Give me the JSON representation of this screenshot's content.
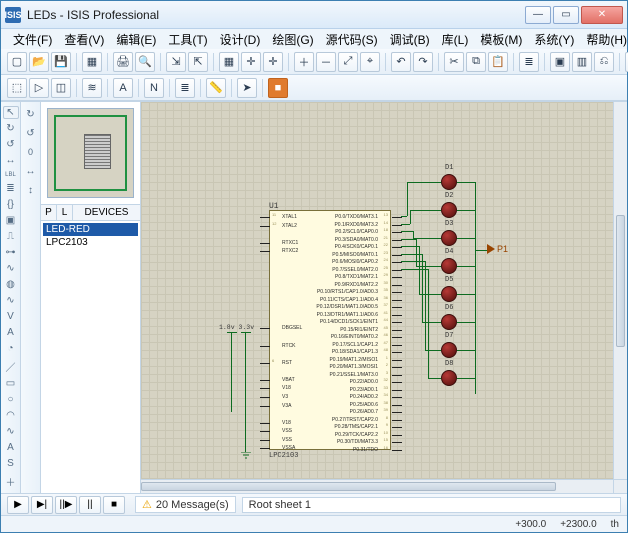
{
  "window": {
    "app_icon_text": "ISIS",
    "title": "LEDs - ISIS Professional",
    "btn_min": "—",
    "btn_max": "▭",
    "btn_close": "✕"
  },
  "menu": {
    "items": [
      "文件(F)",
      "查看(V)",
      "编辑(E)",
      "工具(T)",
      "设计(D)",
      "绘图(G)",
      "源代码(S)",
      "调试(B)",
      "库(L)",
      "模板(M)",
      "系统(Y)",
      "帮助(H)"
    ]
  },
  "toolbar1": {
    "icons": [
      "new-file",
      "open-file",
      "save-file",
      "sep",
      "section-area",
      "sep",
      "print",
      "preview",
      "sep",
      "import",
      "export",
      "sep",
      "grid-toggle",
      "snap-origin",
      "center",
      "sep",
      "zoom-in",
      "zoom-out",
      "zoom-all",
      "zoom-area",
      "sep",
      "undo",
      "redo",
      "sep",
      "cut",
      "copy",
      "paste",
      "sep",
      "layers",
      "sep",
      "component-mode",
      "package-mode",
      "decompose",
      "sep",
      "wire-tool",
      "autoroute",
      "find",
      "sep",
      "erc",
      "netlist",
      "bom",
      "sep",
      "to-ares"
    ]
  },
  "toolbar2": {
    "icons": [
      "sel-mode",
      "run-reset",
      "select-box",
      "sep",
      "trace-view",
      "sep",
      "text-label",
      "sep",
      "net-label",
      "sep",
      "layers-tool",
      "sep",
      "ruler",
      "sep",
      "arrow",
      "sep",
      "orange-mode"
    ]
  },
  "left_palette": {
    "tools": [
      "select",
      "rotate-cw",
      "rotate-ccw",
      "mirror-h",
      "label",
      "bus",
      "script",
      "subckt",
      "terminal",
      "pin",
      "graph",
      "tape",
      "generator",
      "voltmeter",
      "ammeter",
      "oscilloscope",
      "line-2d",
      "rect-2d",
      "circle-2d",
      "arc-2d",
      "path-2d",
      "text-2d",
      "symbol",
      "plus"
    ]
  },
  "device_browser": {
    "tabs": {
      "p": "P",
      "l": "L",
      "title": "DEVICES"
    },
    "items": [
      {
        "name": "LED-RED",
        "selected": true
      },
      {
        "name": "LPC2103",
        "selected": false
      }
    ]
  },
  "schematic": {
    "chip_ref": "U1",
    "chip_value": "LPC2103",
    "power_label": "1.8v   3.3v",
    "left_pins": [
      {
        "n": "11",
        "l": "XTAL1"
      },
      {
        "n": "12",
        "l": "XTAL2"
      },
      {
        "n": "",
        "l": ""
      },
      {
        "n": "",
        "l": "RTXC1"
      },
      {
        "n": "",
        "l": "RTXC2"
      },
      {
        "n": "",
        "l": ""
      },
      {
        "n": "",
        "l": ""
      },
      {
        "n": "",
        "l": ""
      },
      {
        "n": "",
        "l": ""
      },
      {
        "n": "",
        "l": ""
      },
      {
        "n": "",
        "l": ""
      },
      {
        "n": "",
        "l": ""
      },
      {
        "n": "",
        "l": ""
      },
      {
        "n": "",
        "l": "DBGSEL"
      },
      {
        "n": "",
        "l": ""
      },
      {
        "n": "",
        "l": "RTCK"
      },
      {
        "n": "",
        "l": ""
      },
      {
        "n": "6",
        "l": "RST"
      },
      {
        "n": "",
        "l": ""
      },
      {
        "n": "",
        "l": "VBAT"
      },
      {
        "n": "",
        "l": "V18"
      },
      {
        "n": "",
        "l": "V3"
      },
      {
        "n": "",
        "l": "V3A"
      },
      {
        "n": "",
        "l": ""
      },
      {
        "n": "",
        "l": "V18"
      },
      {
        "n": "",
        "l": "VSS"
      },
      {
        "n": "",
        "l": "VSS"
      },
      {
        "n": "",
        "l": "VSSA"
      }
    ],
    "right_pins": [
      {
        "l": "P0.0/TXD0/MAT3.1",
        "n": "13"
      },
      {
        "l": "P0.1/RXD0/MAT3.2",
        "n": "14"
      },
      {
        "l": "P0.2/SCL0/CAP0.0",
        "n": "18"
      },
      {
        "l": "P0.3/SDA0/MAT0.0",
        "n": "21"
      },
      {
        "l": "P0.4/SCK0/CAP0.1",
        "n": "22"
      },
      {
        "l": "P0.5/MISO0/MAT0.1",
        "n": "23"
      },
      {
        "l": "P0.6/MOSI0/CAP0.2",
        "n": "24"
      },
      {
        "l": "P0.7/SSEL0/MAT2.0",
        "n": "25"
      },
      {
        "l": "P0.8/TXD1/MAT2.1",
        "n": "29"
      },
      {
        "l": "P0.9/RXD1/MAT2.2",
        "n": "30"
      },
      {
        "l": "P0.10/RTS1/CAP1.0/AD0.3",
        "n": "35"
      },
      {
        "l": "P0.11/CTS/CAP1.1/AD0.4",
        "n": "36"
      },
      {
        "l": "P0.12/DSR1/MAT1.0/AD0.5",
        "n": "37"
      },
      {
        "l": "P0.13/DTR1/MAT1.1/AD0.6",
        "n": "41"
      },
      {
        "l": "P0.14/DCD1/SCK1/EINT1",
        "n": "44"
      },
      {
        "l": "P0.15/RI1/EINT2",
        "n": "45"
      },
      {
        "l": "P0.16/EINT0/MAT0.2",
        "n": "46"
      },
      {
        "l": "P0.17/SCL1/CAP1.2",
        "n": "47"
      },
      {
        "l": "P0.18/SDA1/CAP1.3",
        "n": "48"
      },
      {
        "l": "P0.19/MAT1.2/MISO1",
        "n": "1"
      },
      {
        "l": "P0.20/MAT1.3/MOSI1",
        "n": "2"
      },
      {
        "l": "P0.21/SSEL1/MAT3.0",
        "n": "3"
      },
      {
        "l": "P0.22/AD0.0",
        "n": "32"
      },
      {
        "l": "P0.23/AD0.1",
        "n": "33"
      },
      {
        "l": "P0.24/AD0.2",
        "n": "34"
      },
      {
        "l": "P0.25/AD0.6",
        "n": "38"
      },
      {
        "l": "P0.26/AD0.7",
        "n": "39"
      },
      {
        "l": "P0.27/TRST/CAP2.0",
        "n": "8"
      },
      {
        "l": "P0.28/TMS/CAP2.1",
        "n": "9"
      },
      {
        "l": "P0.29/TCK/CAP2.2",
        "n": "10"
      },
      {
        "l": "P0.30/TDI/MAT3.3",
        "n": "15"
      },
      {
        "l": "P0.31/TDO",
        "n": "16"
      }
    ],
    "leds": [
      {
        "ref": "D1"
      },
      {
        "ref": "D2"
      },
      {
        "ref": "D3"
      },
      {
        "ref": "D4"
      },
      {
        "ref": "D5"
      },
      {
        "ref": "D6"
      },
      {
        "ref": "D7"
      },
      {
        "ref": "D8"
      }
    ],
    "probe_label": "P1"
  },
  "simbar": {
    "play": "▶",
    "step": "▶|",
    "frame": "||▶",
    "pause": "||",
    "stop": "■",
    "warn_icon": "⚠",
    "messages": "20 Message(s)",
    "sheet": "Root sheet 1"
  },
  "status": {
    "coord1": "+300.0",
    "coord2": "+2300.0",
    "unit": "th"
  }
}
